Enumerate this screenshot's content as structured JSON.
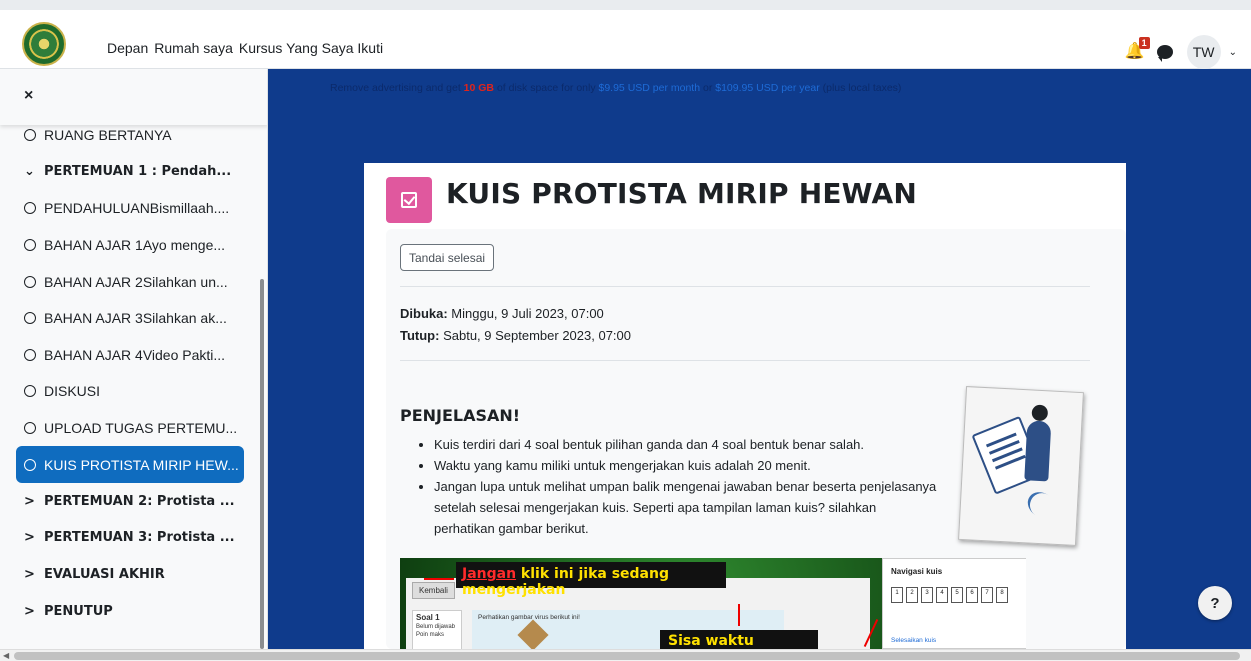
{
  "nav": {
    "links": [
      "Depan",
      "Rumah saya",
      "Kursus Yang Saya Ikuti"
    ],
    "notif_count": "1",
    "avatar_initials": "TW"
  },
  "sidebar": {
    "close_label": "×",
    "items": [
      {
        "label": "RUANG BERTANYA",
        "kind": "activity"
      },
      {
        "label": "PERTEMUAN 1 : Pendah...",
        "kind": "section-open"
      },
      {
        "label": "PENDAHULUANBismillaah....",
        "kind": "activity"
      },
      {
        "label": "BAHAN AJAR 1Ayo menge...",
        "kind": "activity"
      },
      {
        "label": "BAHAN AJAR 2Silahkan un...",
        "kind": "activity"
      },
      {
        "label": "BAHAN AJAR 3Silahkan ak...",
        "kind": "activity"
      },
      {
        "label": "BAHAN AJAR 4Video Pakti...",
        "kind": "activity"
      },
      {
        "label": "DISKUSI",
        "kind": "activity"
      },
      {
        "label": "UPLOAD TUGAS PERTEMU...",
        "kind": "activity"
      },
      {
        "label": "KUIS PROTISTA MIRIP HEW...",
        "kind": "active"
      },
      {
        "label": "PERTEMUAN 2: Protista ...",
        "kind": "section"
      },
      {
        "label": "PERTEMUAN 3: Protista ...",
        "kind": "section"
      },
      {
        "label": "EVALUASI AKHIR",
        "kind": "section"
      },
      {
        "label": "PENUTUP",
        "kind": "section"
      }
    ]
  },
  "ad": {
    "part1": "Remove advertising and get ",
    "highlight": "10 GB",
    "part2": " of disk space for only ",
    "price_month": "$9.95 USD per month",
    "part3": " or ",
    "price_year": "$109.95 USD per year",
    "part4": " (plus local taxes)"
  },
  "quiz": {
    "title": "KUIS PROTISTA MIRIP HEWAN",
    "mark_done": "Tandai selesai",
    "opened_label": "Dibuka:",
    "opened_value": " Minggu, 9 Juli 2023, 07:00",
    "closed_label": "Tutup:",
    "closed_value": " Sabtu, 9 September 2023, 07:00",
    "heading": "PENJELASAN!",
    "bullets": [
      "Kuis terdiri dari 4 soal bentuk pilihan ganda dan 4 soal bentuk benar salah.",
      "Waktu yang kamu miliki untuk mengerjakan kuis adalah 20 menit.",
      "Jangan lupa untuk melihat umpan balik mengenai jawaban benar beserta penjelasanya setelah selesai mengerjakan kuis. Seperti apa tampilan laman kuis? silahkan perhatikan gambar berikut."
    ]
  },
  "screenshot": {
    "kembali": "Kembali",
    "label1_red": "Jangan",
    "label1_yellow": " klik ini jika sedang mengerjakan",
    "label2": "Sisa waktu pengerjaan",
    "soal_title": "Soal 1",
    "soal_line1": "Belum dijawab",
    "soal_line2": "Poin maks",
    "question_text": "Perhatikan gambar virus berikut ini!",
    "nav_title": "Navigasi kuis",
    "nav_numbers": [
      "1",
      "2",
      "3",
      "4",
      "5",
      "6",
      "7",
      "8"
    ],
    "nav_link": "Selesaikan kuis"
  },
  "help_label": "?"
}
